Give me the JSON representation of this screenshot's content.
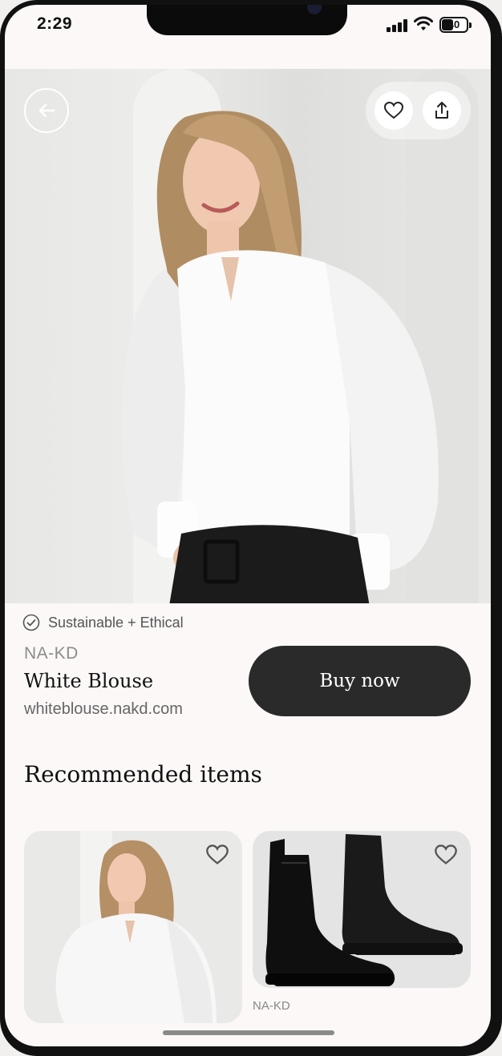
{
  "status_bar": {
    "time": "2:29",
    "battery_level": "40"
  },
  "hero": {
    "back_icon": "arrow-left-icon",
    "favorite_icon": "heart-icon",
    "share_icon": "share-icon"
  },
  "product": {
    "badge": "Sustainable + Ethical",
    "brand": "NA-KD",
    "name": "White Blouse",
    "url": "whiteblouse.nakd.com",
    "buy_label": "Buy now"
  },
  "recommended": {
    "title": "Recommended items",
    "items": [
      {
        "image": "white-blouse-model",
        "brand": ""
      },
      {
        "image": "black-chelsea-boots",
        "brand": "NA-KD"
      }
    ]
  },
  "colors": {
    "accent_dark": "#2a2a2a",
    "background": "#fbf8f7"
  }
}
